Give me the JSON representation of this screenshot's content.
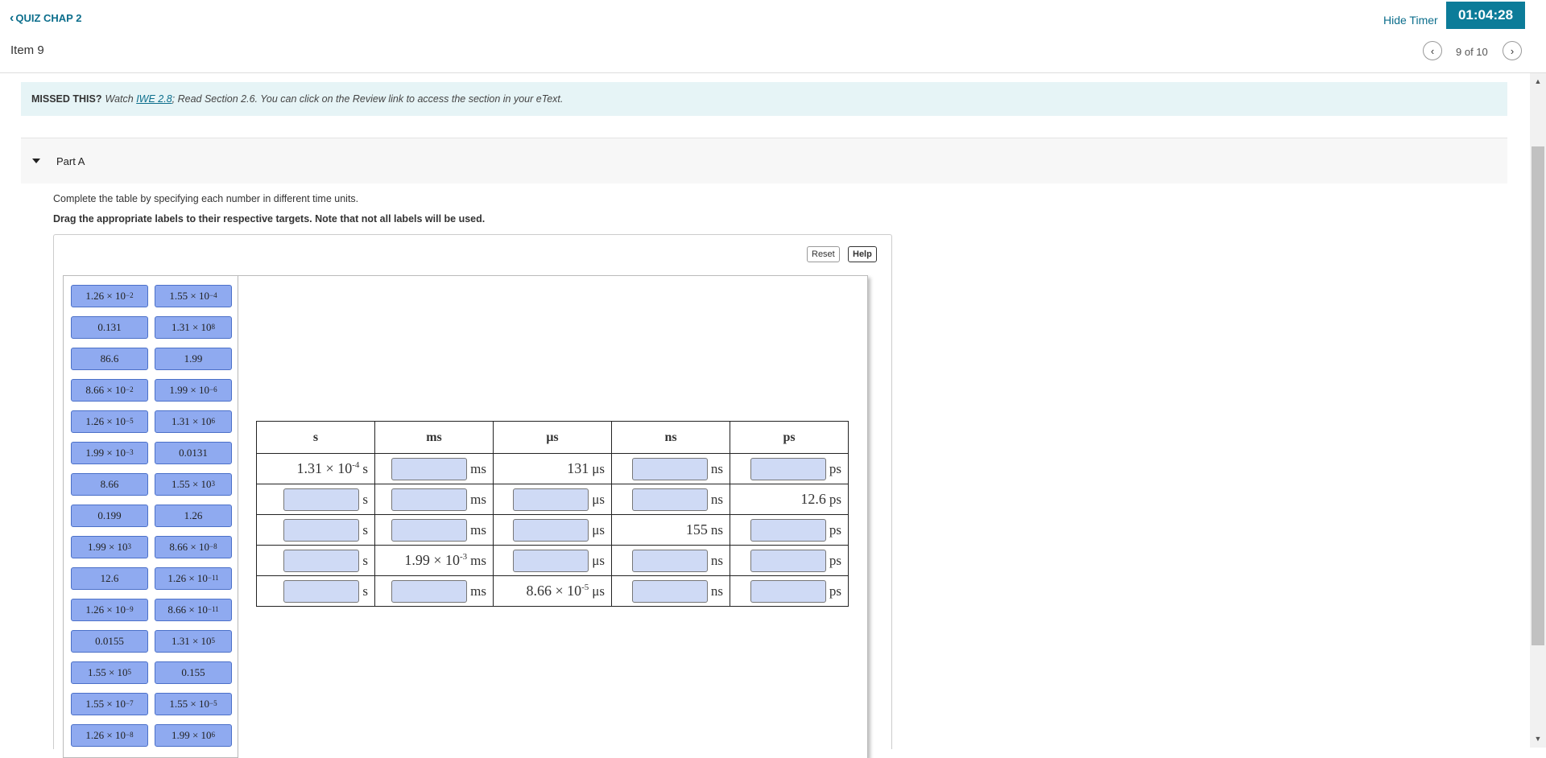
{
  "header": {
    "back_label": "QUIZ CHAP 2",
    "item_title": "Item 9",
    "hide_timer": "Hide Timer",
    "timer": "01:04:28",
    "pager": "9 of 10"
  },
  "missed": {
    "label": "MISSED THIS?",
    "watch": "Watch",
    "link": "IWE 2.8",
    "rest": "; Read Section 2.6. You can click on the Review link to access the section in your eText."
  },
  "part": {
    "title": "Part A",
    "instruction": "Complete the table by specifying each number in different time units.",
    "drag_instruction": "Drag the appropriate labels to their respective targets. Note that not all labels will be used.",
    "reset_label": "Reset",
    "help_label": "Help"
  },
  "labels": [
    {
      "base": "1.26 × 10",
      "exp": "−2"
    },
    {
      "base": "1.55 × 10",
      "exp": "−4"
    },
    {
      "base": "0.131",
      "exp": ""
    },
    {
      "base": "1.31 × 10",
      "exp": "8"
    },
    {
      "base": "86.6",
      "exp": ""
    },
    {
      "base": "1.99",
      "exp": ""
    },
    {
      "base": "8.66 × 10",
      "exp": "−2"
    },
    {
      "base": "1.99 × 10",
      "exp": "−6"
    },
    {
      "base": "1.26 × 10",
      "exp": "−5"
    },
    {
      "base": "1.31 × 10",
      "exp": "6"
    },
    {
      "base": "1.99 × 10",
      "exp": "−3"
    },
    {
      "base": "0.0131",
      "exp": ""
    },
    {
      "base": "8.66",
      "exp": ""
    },
    {
      "base": "1.55 × 10",
      "exp": "3"
    },
    {
      "base": "0.199",
      "exp": ""
    },
    {
      "base": "1.26",
      "exp": ""
    },
    {
      "base": "1.99 × 10",
      "exp": "3"
    },
    {
      "base": "8.66 × 10",
      "exp": "−8"
    },
    {
      "base": "12.6",
      "exp": ""
    },
    {
      "base": "1.26 × 10",
      "exp": "−11"
    },
    {
      "base": "1.26 × 10",
      "exp": "−9"
    },
    {
      "base": "8.66 × 10",
      "exp": "−11"
    },
    {
      "base": "0.0155",
      "exp": ""
    },
    {
      "base": "1.31 × 10",
      "exp": "5"
    },
    {
      "base": "1.55 × 10",
      "exp": "5"
    },
    {
      "base": "0.155",
      "exp": ""
    },
    {
      "base": "1.55 × 10",
      "exp": "−7"
    },
    {
      "base": "1.55 × 10",
      "exp": "−5"
    },
    {
      "base": "1.26 × 10",
      "exp": "−8"
    },
    {
      "base": "1.99 × 10",
      "exp": "6"
    }
  ],
  "table": {
    "headers": [
      "s",
      "ms",
      "μs",
      "ns",
      "ps"
    ],
    "units": [
      "s",
      "ms",
      "μs",
      "ns",
      "ps"
    ],
    "rows": [
      [
        {
          "base": "1.31 × 10",
          "exp": "-4"
        },
        null,
        {
          "base": "131",
          "exp": ""
        },
        null,
        null
      ],
      [
        null,
        null,
        null,
        null,
        {
          "base": "12.6",
          "exp": ""
        }
      ],
      [
        null,
        null,
        null,
        {
          "base": "155",
          "exp": ""
        },
        null
      ],
      [
        null,
        {
          "base": "1.99 × 10",
          "exp": "-3"
        },
        null,
        null,
        null
      ],
      [
        null,
        null,
        {
          "base": "8.66 × 10",
          "exp": "-5"
        },
        null,
        null
      ]
    ]
  }
}
